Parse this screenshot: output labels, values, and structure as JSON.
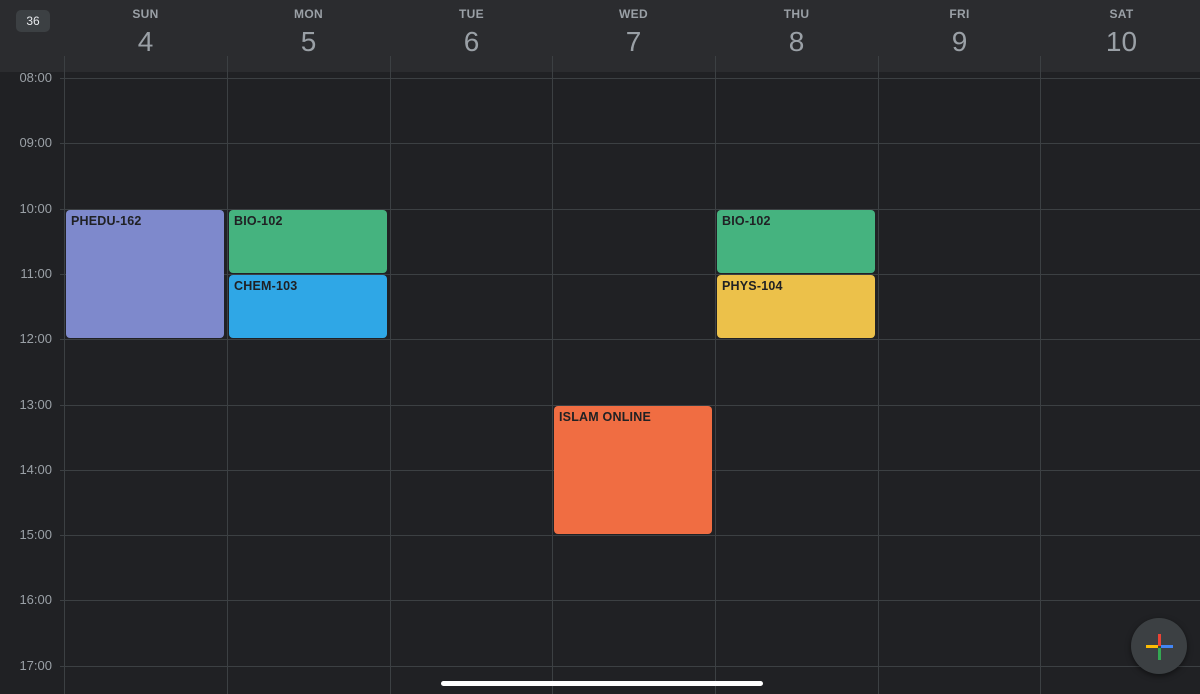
{
  "header": {
    "week_number": "36",
    "days": [
      {
        "name": "SUN",
        "number": "4"
      },
      {
        "name": "MON",
        "number": "5"
      },
      {
        "name": "TUE",
        "number": "6"
      },
      {
        "name": "WED",
        "number": "7"
      },
      {
        "name": "THU",
        "number": "8"
      },
      {
        "name": "FRI",
        "number": "9"
      },
      {
        "name": "SAT",
        "number": "10"
      }
    ]
  },
  "hours": [
    "08:00",
    "09:00",
    "10:00",
    "11:00",
    "12:00",
    "13:00",
    "14:00",
    "15:00",
    "16:00",
    "17:00"
  ],
  "events": [
    {
      "title": "PHEDU-162",
      "day": 0,
      "start": "10:00",
      "end": "12:00",
      "color": "#7e89cc"
    },
    {
      "title": "BIO-102",
      "day": 1,
      "start": "10:00",
      "end": "11:00",
      "color": "#45b37f"
    },
    {
      "title": "CHEM-103",
      "day": 1,
      "start": "11:00",
      "end": "12:00",
      "color": "#2fa7e6"
    },
    {
      "title": "ISLAM ONLINE",
      "day": 3,
      "start": "13:00",
      "end": "15:00",
      "color": "#f06d42"
    },
    {
      "title": "BIO-102",
      "day": 4,
      "start": "10:00",
      "end": "11:00",
      "color": "#45b37f"
    },
    {
      "title": "PHYS-104",
      "day": 4,
      "start": "11:00",
      "end": "12:00",
      "color": "#ecc14a"
    }
  ],
  "fab": {
    "icon": "plus-icon",
    "colors": [
      "#ea4335",
      "#4285f4",
      "#34a853",
      "#fbbc04"
    ]
  }
}
